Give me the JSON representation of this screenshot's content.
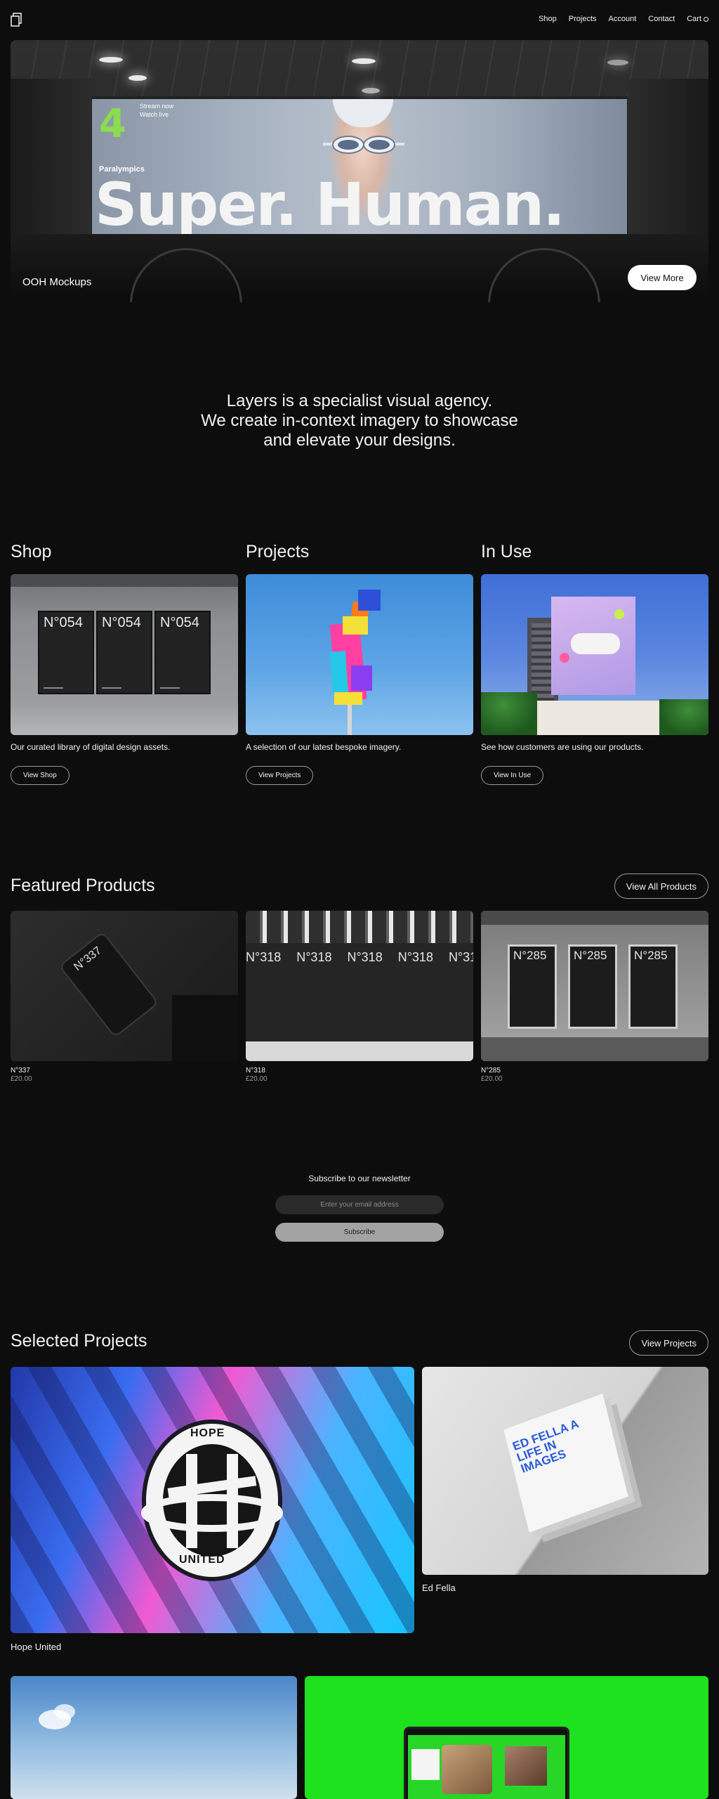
{
  "header": {
    "logo_icon": "layers-logo-icon",
    "nav": [
      "Shop",
      "Projects",
      "Account",
      "Contact",
      "Cart"
    ]
  },
  "hero": {
    "billboard": {
      "channel_mark": "4",
      "stream_line1": "Stream now",
      "stream_line2": "Watch live",
      "event": "Paralympics",
      "headline": "Super. Human."
    },
    "caption": "OOH Mockups",
    "button": "View More"
  },
  "intro": {
    "line1": "Layers is a specialist visual agency.",
    "line2": "We create in-context imagery to showcase",
    "line3": "and elevate your designs."
  },
  "categories": [
    {
      "title": "Shop",
      "description": "Our curated library of digital design assets.",
      "button": "View Shop",
      "poster_label": "N°054"
    },
    {
      "title": "Projects",
      "description": "A selection of our latest bespoke imagery.",
      "button": "View Projects"
    },
    {
      "title": "In Use",
      "description": "See how customers are using our products.",
      "button": "View In Use"
    }
  ],
  "featured": {
    "title": "Featured Products",
    "button": "View All Products",
    "products": [
      {
        "name": "N°337",
        "price": "£20.00",
        "label": "N°337"
      },
      {
        "name": "N°318",
        "price": "£20.00",
        "label": "N°318"
      },
      {
        "name": "N°285",
        "price": "£20.00",
        "label": "N°285"
      }
    ]
  },
  "newsletter": {
    "title": "Subscribe to our newsletter",
    "placeholder": "Enter your email address",
    "button": "Subscribe"
  },
  "selected_projects": {
    "title": "Selected Projects",
    "button": "View Projects",
    "items": [
      {
        "caption": "Hope United",
        "badge_top": "HOPE",
        "badge_bottom": "UNITED"
      },
      {
        "caption": "Ed Fella",
        "book_text": "ED FELLA A LIFE IN IMAGES"
      }
    ]
  },
  "colors": {
    "background": "#0d0d0d",
    "text": "#f2f2f2",
    "muted": "#9a9a9a",
    "green_project": "#1ee21e"
  }
}
